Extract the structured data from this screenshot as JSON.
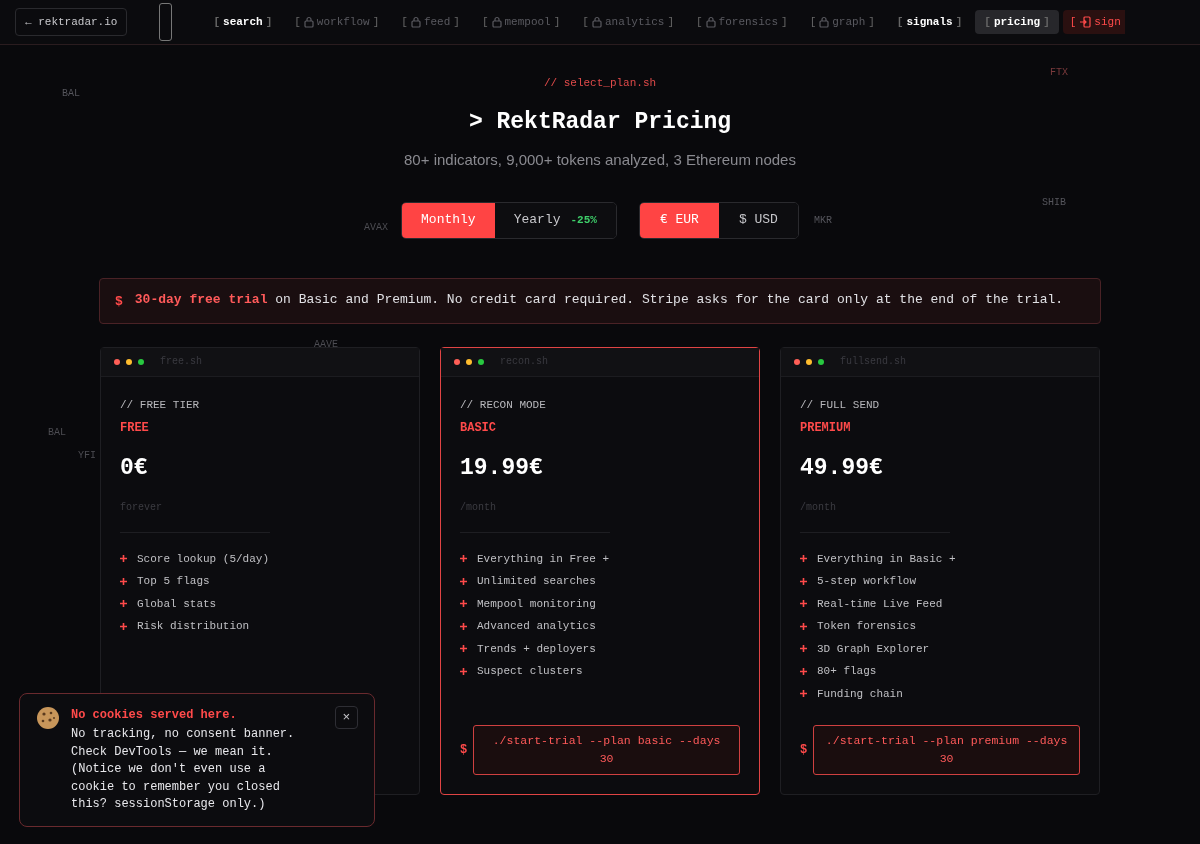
{
  "nav": {
    "back_link": "← rektradar.io",
    "bracket_open": "[",
    "bracket_close": "]",
    "items": [
      {
        "label": "search",
        "locked": false,
        "selected": false
      },
      {
        "label": "workflow",
        "locked": true,
        "selected": false
      },
      {
        "label": "feed",
        "locked": true,
        "selected": false
      },
      {
        "label": "mempool",
        "locked": true,
        "selected": false
      },
      {
        "label": "analytics",
        "locked": true,
        "selected": false
      },
      {
        "label": "forensics",
        "locked": true,
        "selected": false
      },
      {
        "label": "graph",
        "locked": true,
        "selected": false
      },
      {
        "label": "signals",
        "locked": false,
        "selected": false
      },
      {
        "label": "pricing",
        "locked": false,
        "selected": true
      }
    ],
    "sign_in": "sign"
  },
  "background_tickers": [
    {
      "label": "BAL",
      "color": "#55555c"
    },
    {
      "label": "FTX",
      "color": "#7a3a3c"
    },
    {
      "label": "AVAX",
      "color": "#4c4c52"
    },
    {
      "label": "MKR",
      "color": "#55555c"
    },
    {
      "label": "SHIB",
      "color": "#55555c"
    },
    {
      "label": "AAVE",
      "color": "#4c4c52"
    },
    {
      "label": "BAL",
      "color": "#4c4c52"
    },
    {
      "label": "YFI",
      "color": "#4c4c52"
    }
  ],
  "header": {
    "script": "// select_plan.sh",
    "title": "> RektRadar Pricing",
    "subtitle": "80+ indicators, 9,000+ tokens analyzed, 3 Ethereum nodes"
  },
  "billing_toggle": [
    {
      "label": "Monthly",
      "selected": true
    },
    {
      "label": "Yearly",
      "badge": "-25%",
      "selected": false
    }
  ],
  "currency_toggle": [
    {
      "label": "€ EUR",
      "selected": true
    },
    {
      "label": "$ USD",
      "selected": false
    }
  ],
  "trial_banner": {
    "icon": "$",
    "text": "**30-day free trial** on Basic and Premium. No credit card required. Stripe asks for the card only at the end of the trial."
  },
  "plans": [
    {
      "file": "free.sh",
      "tag": "// FREE TIER",
      "name": "FREE",
      "price": "0€",
      "period": "forever",
      "highlighted": false,
      "features": [
        "Score lookup (5/day)",
        "Top 5 flags",
        "Global stats",
        "Risk distribution"
      ]
    },
    {
      "file": "recon.sh",
      "tag": "// RECON MODE",
      "name": "BASIC",
      "price": "19.99€",
      "period": "/month",
      "highlighted": true,
      "features": [
        "Everything in Free +",
        "Unlimited searches",
        "Mempool monitoring",
        "Advanced analytics",
        "Trends + deployers",
        "Suspect clusters"
      ],
      "prompt": "$",
      "cta": "./start-trial --plan basic --days 30"
    },
    {
      "file": "fullsend.sh",
      "tag": "// FULL SEND",
      "name": "PREMIUM",
      "price": "49.99€",
      "period": "/month",
      "highlighted": false,
      "features": [
        "Everything in Basic +",
        "5-step workflow",
        "Real-time Live Feed",
        "Token forensics",
        "3D Graph Explorer",
        "80+ flags",
        "Funding chain"
      ],
      "prompt": "$",
      "cta": "./start-trial --plan premium --days 30"
    }
  ],
  "cookie_toast": {
    "title": "No cookies served here.",
    "body": "No tracking, no consent banner. Check DevTools — we mean it. (Notice we don't even use a cookie to remember you closed this? sessionStorage only.)",
    "close": "×"
  }
}
